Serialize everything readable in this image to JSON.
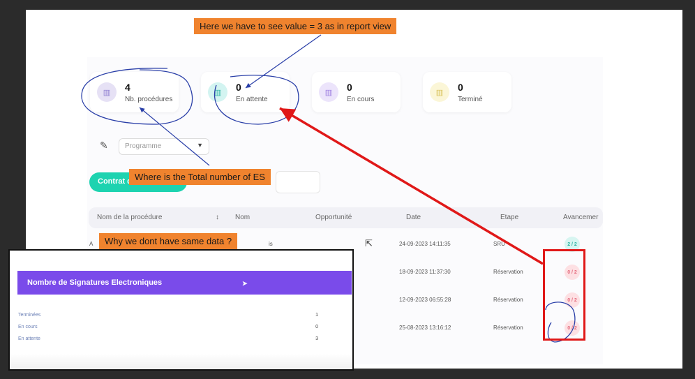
{
  "cards": [
    {
      "value": "4",
      "label": "Nb. procédures",
      "color": "#e6e1f5",
      "icon": "chart-icon"
    },
    {
      "value": "0",
      "label": "En attente",
      "color": "#d3f4f1",
      "icon": "chart-icon"
    },
    {
      "value": "0",
      "label": "En cours",
      "color": "#ece4fb",
      "icon": "chart-icon"
    },
    {
      "value": "0",
      "label": "Terminé",
      "color": "#fbf6d7",
      "icon": "chart-icon"
    }
  ],
  "filter": {
    "placeholder": "Programme"
  },
  "button": {
    "label": "Contrat d"
  },
  "table": {
    "headers": [
      "Nom de la procédure",
      "Nom",
      "Opportunité",
      "Date",
      "Etape",
      "Avancemer"
    ],
    "rows": [
      {
        "prefix": "A",
        "nom_fragment": "is",
        "date": "24-09-2023 14:11:35",
        "etape": "SRU",
        "progress": "2 / 2",
        "badge_color": "#d7f5f1",
        "badge_text_color": "#2bb3a3"
      },
      {
        "date": "18-09-2023 11:37:30",
        "etape": "Réservation",
        "progress": "0 / 2",
        "badge_color": "#fde0e3",
        "badge_text_color": "#e46a7d"
      },
      {
        "date": "12-09-2023 06:55:28",
        "etape": "Réservation",
        "progress": "0 / 2",
        "badge_color": "#fde0e3",
        "badge_text_color": "#e46a7d"
      },
      {
        "date": "25-08-2023 13:16:12",
        "etape": "Réservation",
        "progress": "0 / 2",
        "badge_color": "#fde0e3",
        "badge_text_color": "#e46a7d"
      }
    ]
  },
  "annotations": {
    "top": "Here we have to see value = 3 as in report view",
    "middle": "Where is the Total number of ES",
    "bottom": "Why we dont have same data ?"
  },
  "report": {
    "title": "Nombre de Signatures Electroniques",
    "rows": [
      {
        "label": "Terminées",
        "value": "1"
      },
      {
        "label": "En cours",
        "value": "0"
      },
      {
        "label": "En attente",
        "value": "3"
      }
    ]
  },
  "colors": {
    "accent_teal": "#1dd3b0",
    "report_purple": "#7a4bea",
    "annotation_orange": "#f0832e",
    "highlight_red": "#e01818",
    "pen_blue": "#2a3fa8"
  }
}
